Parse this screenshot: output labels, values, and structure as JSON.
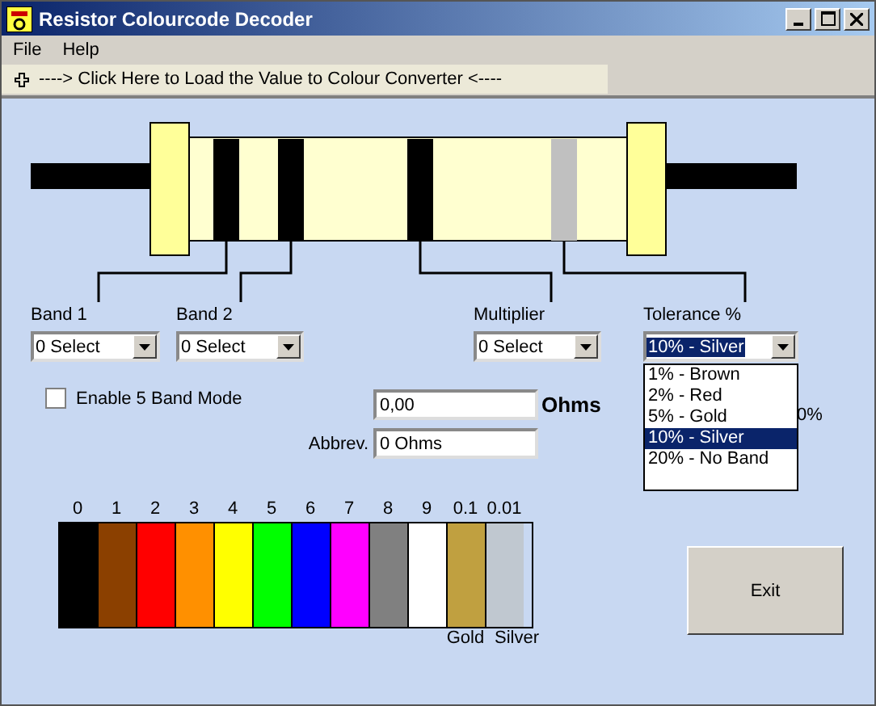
{
  "window": {
    "title": "Resistor Colourcode Decoder"
  },
  "menu": [
    "File",
    "Help"
  ],
  "toolbar": {
    "link": "----> Click Here to Load the Value to Colour Converter <----"
  },
  "resistor": {
    "bands": [
      {
        "color": "#000000"
      },
      {
        "color": "#000000"
      },
      {
        "color": "#000000"
      },
      {
        "color": "#c0c0c0"
      }
    ]
  },
  "selectors": [
    {
      "label": "Band 1",
      "value": "0 Select",
      "focused": false
    },
    {
      "label": "Band 2",
      "value": "0 Select",
      "focused": false
    },
    {
      "label": "Multiplier",
      "value": "0 Select",
      "focused": false
    },
    {
      "label": "Tolerance %",
      "value": "10% - Silver",
      "focused": true
    }
  ],
  "tolerance_options": [
    {
      "label": "1% - Brown",
      "selected": false
    },
    {
      "label": "2% - Red",
      "selected": false
    },
    {
      "label": "5% - Gold",
      "selected": false
    },
    {
      "label": "10% - Silver",
      "selected": true
    },
    {
      "label": "20% - No Band",
      "selected": false
    }
  ],
  "five_band_mode": {
    "label": "Enable 5 Band Mode",
    "checked": false
  },
  "result": {
    "value": "0,00",
    "unit": "Ohms",
    "abbrev_label": "Abbrev.",
    "abbrev_value": "0 Ohms"
  },
  "hidden_fragment": "0%",
  "colour_chart": [
    {
      "digit": "0",
      "color": "#000000"
    },
    {
      "digit": "1",
      "color": "#8b4000"
    },
    {
      "digit": "2",
      "color": "#ff0000"
    },
    {
      "digit": "3",
      "color": "#ff9000"
    },
    {
      "digit": "4",
      "color": "#ffff00"
    },
    {
      "digit": "5",
      "color": "#00ff00"
    },
    {
      "digit": "6",
      "color": "#0000ff"
    },
    {
      "digit": "7",
      "color": "#ff00ff"
    },
    {
      "digit": "8",
      "color": "#808080"
    },
    {
      "digit": "9",
      "color": "#ffffff"
    },
    {
      "digit": "0.1",
      "color": "#c0a040",
      "name": "Gold"
    },
    {
      "digit": "0.01",
      "color": "#c0c8d0",
      "name": "Silver"
    }
  ],
  "exit_button": "Exit"
}
